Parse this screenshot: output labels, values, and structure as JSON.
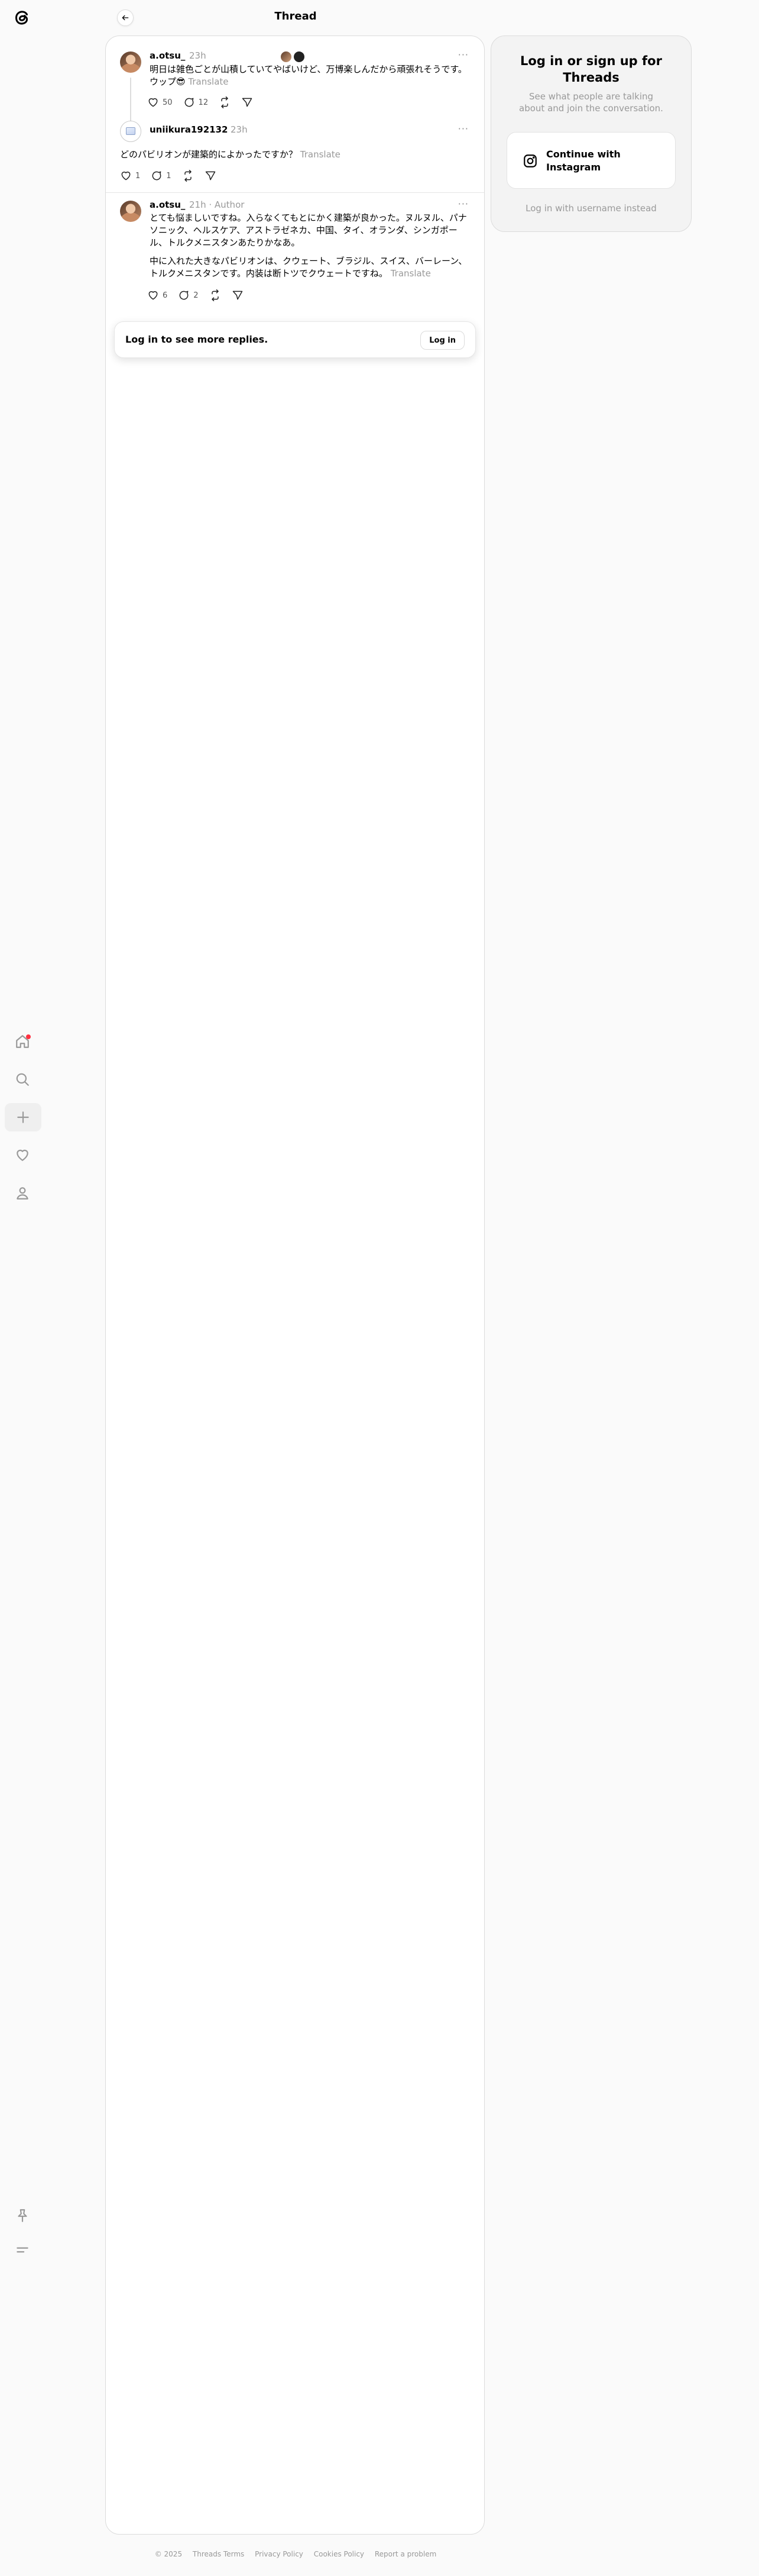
{
  "header": {
    "title": "Thread"
  },
  "nav": {
    "icons": [
      "threads-logo-icon",
      "home-icon",
      "search-icon",
      "plus-icon",
      "heart-icon",
      "user-icon",
      "pin-icon",
      "menu-icon"
    ]
  },
  "posts": [
    {
      "username": "a.otsu_",
      "time": "23h",
      "tag": "",
      "text": "明日は雑色ごとが山積していてやばいけど、万博楽しんだから頑張れそうです。ウップ😎",
      "translate": "Translate",
      "likes": "50",
      "replies": "12"
    },
    {
      "username": "uniikura192132",
      "time": "23h",
      "tag": "",
      "text": "どのパビリオンが建築的によかったですか？",
      "translate": "Translate",
      "likes": "1",
      "replies": "1"
    },
    {
      "username": "a.otsu_",
      "time": "21h",
      "tag": "· Author",
      "text": "とても悩ましいですね。入らなくてもとにかく建築が良かった。ヌルヌル、パナソニック、ヘルスケア、アストラゼネカ、中国、タイ、オランダ、シンガポール、トルクメニスタンあたりかなあ。",
      "text2": "中に入れた大きなパビリオンは、クウェート、ブラジル、スイス、バーレーン、トルクメニスタンです。内装は断トツでクウェートですね。",
      "translate": "Translate",
      "likes": "6",
      "replies": "2"
    }
  ],
  "login_prompt": {
    "text": "Log in to see more replies.",
    "button": "Log in"
  },
  "side": {
    "title": "Log in or sign up for Threads",
    "subtitle": "See what people are talking about and join the conversation.",
    "instagram_button": "Continue with Instagram",
    "alt_login": "Log in with username instead"
  },
  "footer": {
    "items": [
      "© 2025",
      "Threads Terms",
      "Privacy Policy",
      "Cookies Policy",
      "Report a problem"
    ]
  },
  "colors": {
    "notification_dot": "#ff3040",
    "muted": "#999999"
  }
}
